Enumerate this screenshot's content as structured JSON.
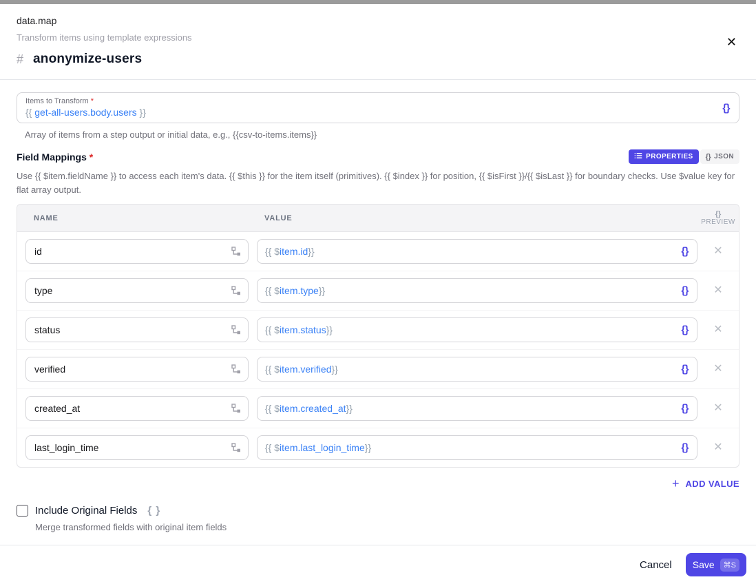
{
  "colors": {
    "accent": "#4f46e5",
    "template_blue": "#3b82f6",
    "muted_gray": "#71717a"
  },
  "icons": {
    "hash": "#",
    "close": "✕",
    "remove": "✕",
    "braces": "{}",
    "braces_spaced": "{ }",
    "plus": "+"
  },
  "header": {
    "app_title": "data.map",
    "subtitle": "Transform items using template expressions",
    "step_name": "anonymize-users"
  },
  "items_to_transform": {
    "label": "Items to Transform",
    "required": "*",
    "value": {
      "open": "{{ ",
      "path": "get-all-users.body.users",
      "close": " }}"
    },
    "helper": "Array of items from a step output or initial data, e.g., {{csv-to-items.items}}"
  },
  "field_mappings": {
    "label": "Field Mappings",
    "required": "*",
    "toggle": {
      "properties": "PROPERTIES",
      "json": "JSON"
    },
    "description": "Use {{ $item.fieldName }} to access each item's data. {{ $this }} for the item itself (primitives). {{ $index }} for position, {{ $isFirst }}/{{ $isLast }} for boundary checks. Use $value key for flat array output.",
    "columns": {
      "name": "NAME",
      "value": "VALUE",
      "preview": "PREVIEW"
    },
    "rows": [
      {
        "name": "id",
        "open": "{{ $",
        "path": "item.id",
        "close": " }}"
      },
      {
        "name": "type",
        "open": "{{ $",
        "path": "item.type",
        "close": " }}"
      },
      {
        "name": "status",
        "open": "{{ $",
        "path": "item.status",
        "close": " }}"
      },
      {
        "name": "verified",
        "open": "{{ $",
        "path": "item.verified",
        "close": " }}"
      },
      {
        "name": "created_at",
        "open": "{{ $",
        "path": "item.created_at",
        "close": " }}"
      },
      {
        "name": "last_login_time",
        "open": "{{ $",
        "path": "item.last_login_time",
        "close": " }}"
      }
    ],
    "add_value": "ADD VALUE"
  },
  "include_original": {
    "label": "Include Original Fields",
    "checked": false,
    "helper": "Merge transformed fields with original item fields"
  },
  "footer": {
    "cancel": "Cancel",
    "save": "Save",
    "shortcut": "⌘S"
  }
}
